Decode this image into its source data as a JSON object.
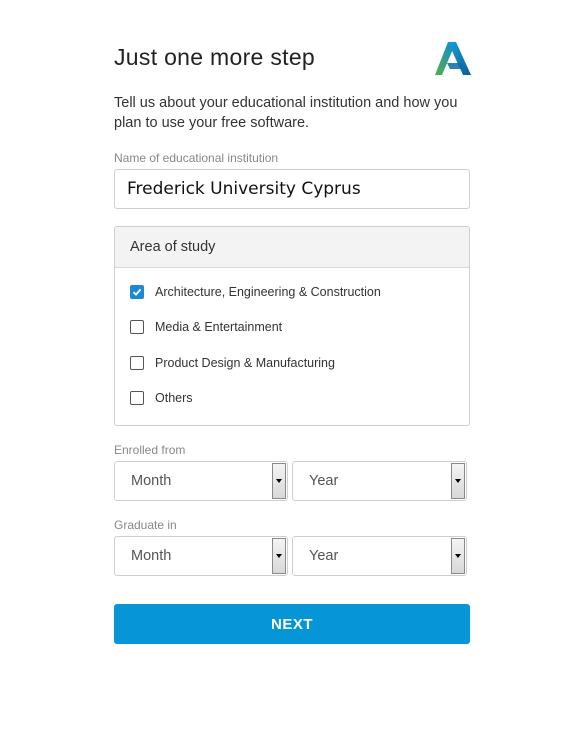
{
  "header": {
    "title": "Just one more step",
    "logo_icon": "autodesk-logo-icon",
    "intro": "Tell us about your educational institution and how you plan to use your free software."
  },
  "institution": {
    "label": "Name of educational institution",
    "value": "Frederick University Cyprus"
  },
  "study": {
    "heading": "Area of study",
    "options": [
      {
        "label": "Architecture, Engineering & Construction",
        "checked": true
      },
      {
        "label": "Media & Entertainment",
        "checked": false
      },
      {
        "label": "Product Design & Manufacturing",
        "checked": false
      },
      {
        "label": "Others",
        "checked": false
      }
    ]
  },
  "enrolled": {
    "label": "Enrolled from",
    "month": "Month",
    "year": "Year"
  },
  "graduate": {
    "label": "Graduate in",
    "month": "Month",
    "year": "Year"
  },
  "next_label": "NEXT",
  "colors": {
    "accent": "#0696d7",
    "checkbox": "#1e88d6"
  }
}
